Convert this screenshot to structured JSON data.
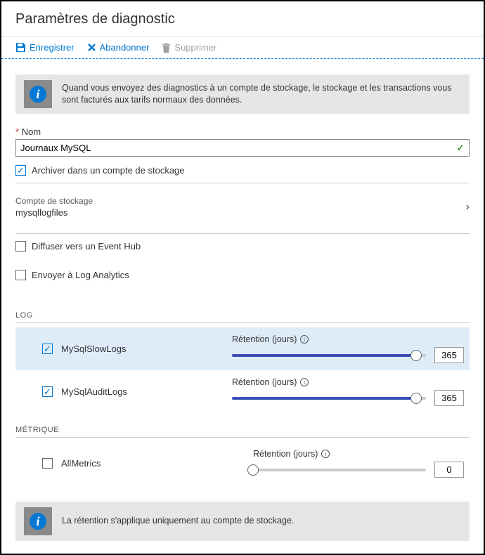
{
  "header": {
    "title": "Paramètres de diagnostic"
  },
  "toolbar": {
    "save": "Enregistrer",
    "discard": "Abandonner",
    "delete": "Supprimer"
  },
  "banner": {
    "text": "Quand vous envoyez des diagnostics à un compte de stockage, le stockage et les transactions vous sont facturés aux tarifs normaux des données."
  },
  "name_field": {
    "label": "Nom",
    "value": "Journaux MySQL"
  },
  "destinations": {
    "archive": {
      "label": "Archiver dans un compte de stockage",
      "checked": true
    },
    "storage": {
      "label": "Compte de stockage",
      "value": "mysqllogfiles"
    },
    "eventhub": {
      "label": "Diffuser vers un Event Hub",
      "checked": false
    },
    "loganalytics": {
      "label": "Envoyer à Log Analytics",
      "checked": false
    }
  },
  "sections": {
    "log_header": "LOG",
    "metric_header": "MÉTRIQUE",
    "retention_label": "Rétention (jours)"
  },
  "logs": [
    {
      "name": "MySqlSlowLogs",
      "checked": true,
      "retention": "365",
      "fill_pct": 95
    },
    {
      "name": "MySqlAuditLogs",
      "checked": true,
      "retention": "365",
      "fill_pct": 95
    }
  ],
  "metrics": [
    {
      "name": "AllMetrics",
      "checked": false,
      "retention": "0",
      "fill_pct": 0
    }
  ],
  "footer_banner": {
    "text": "La rétention s'applique uniquement au compte de stockage."
  }
}
